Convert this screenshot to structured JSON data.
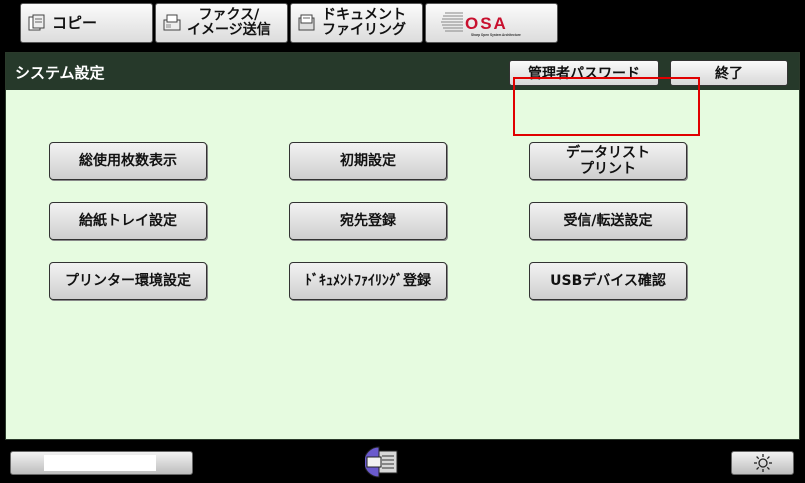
{
  "tabs": [
    {
      "label": "コピー",
      "icon": "copy-icon"
    },
    {
      "label1": "ファクス/",
      "label2": "イメージ送信",
      "icon": "fax-icon"
    },
    {
      "label1": "ドキュメント",
      "label2": "ファイリング",
      "icon": "filing-icon"
    },
    {
      "label": "OSA",
      "sub": "Sharp Open System Architecture",
      "icon": "osa-logo"
    }
  ],
  "header": {
    "title": "システム設定",
    "admin_password": "管理者パスワード",
    "exit": "終了"
  },
  "buttons": {
    "total_count": "総使用枚数表示",
    "default_settings": "初期設定",
    "data_list_print_1": "データリスト",
    "data_list_print_2": "プリント",
    "paper_tray_settings": "給紙トレイ設定",
    "address_registration": "宛先登録",
    "receive_forward_settings": "受信/転送設定",
    "printer_settings": "プリンター環境設定",
    "document_filing_registration": "ﾄﾞｷｭﾒﾝﾄﾌｧｲﾘﾝｸﾞ登録",
    "usb_device_check": "USBデバイス確認"
  },
  "colors": {
    "panel_bg": "#e6fbe0",
    "header_bg": "#26392a",
    "highlight": "#e00000"
  }
}
